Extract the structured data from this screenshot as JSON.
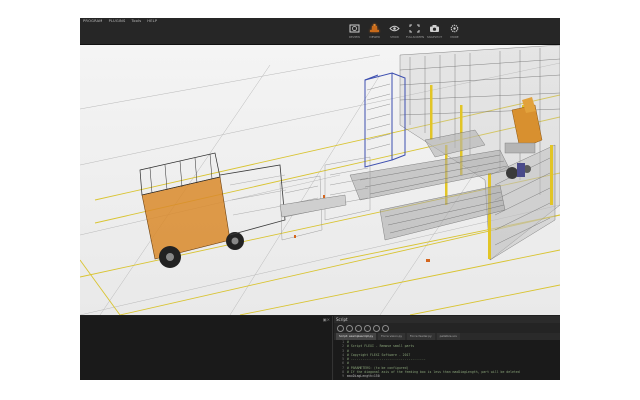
{
  "window": {
    "menu": [
      "PROGRAM",
      "PLUGINS",
      "Tools",
      "HELP"
    ]
  },
  "toolbar": {
    "items": [
      {
        "name": "review-icon",
        "label": "REVIEW"
      },
      {
        "name": "robot-icon",
        "label": "VIEWER",
        "active": true
      },
      {
        "name": "eye-icon",
        "label": "SHOW"
      },
      {
        "name": "fullscreen-icon",
        "label": "FULLSCREEN"
      },
      {
        "name": "camera-icon",
        "label": "SNAPSHOT"
      },
      {
        "name": "settings-icon",
        "label": "MORE"
      }
    ]
  },
  "script_panel": {
    "title": "Script",
    "tabs": [
      {
        "label": "Script: examplescript.py",
        "active": true
      },
      {
        "label": "Force vision.py"
      },
      {
        "label": "Force feeder.py"
      },
      {
        "label": "palletize.scs"
      }
    ],
    "lines": [
      {
        "num": "1",
        "text": "#"
      },
      {
        "num": "2",
        "text": "# Script FLEXI - Remove small parts"
      },
      {
        "num": "3",
        "text": "#"
      },
      {
        "num": "4",
        "text": "# Copyright FLEXI Software - 2017"
      },
      {
        "num": "5",
        "text": "# ---------------------------------------"
      },
      {
        "num": "6",
        "text": "#"
      },
      {
        "num": "7",
        "text": "# PARAMETERS: (to be configured)"
      },
      {
        "num": "8",
        "text": "# If the diagonal axis of the feeding box is less than maxDiagLength, part will be deleted"
      },
      {
        "num": "9",
        "text": "maxDiagLength=150"
      }
    ]
  },
  "colors": {
    "accent": "#c86a1a",
    "floor_line": "#d9c431",
    "panel_bg": "#1f1f1f"
  }
}
